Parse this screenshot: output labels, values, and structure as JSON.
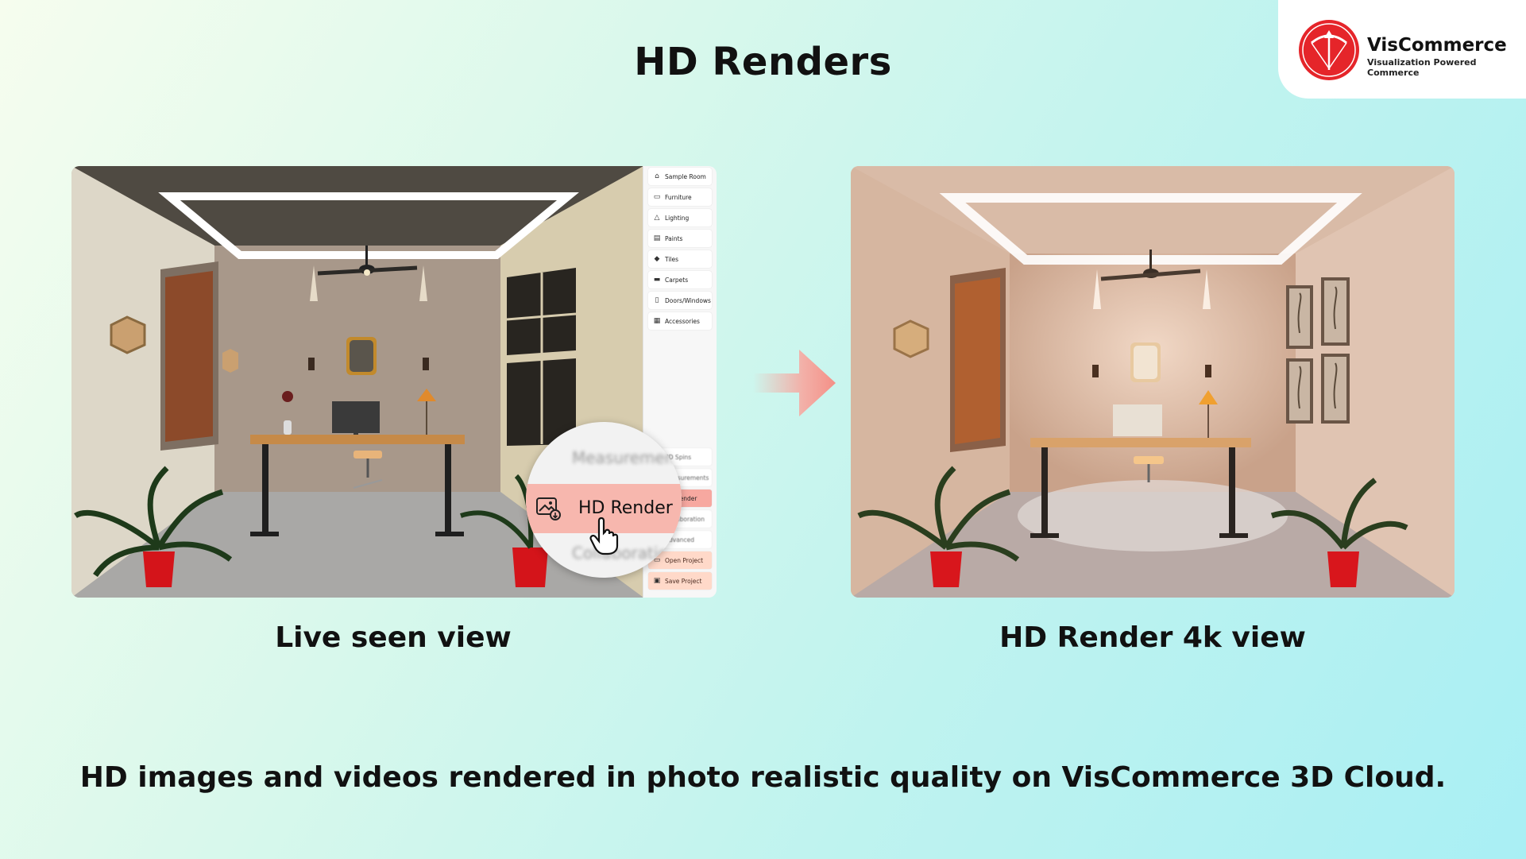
{
  "title": "HD Renders",
  "brand": {
    "name": "VisCommerce",
    "tagline": "Visualization Powered Commerce",
    "accent": "#e5252a"
  },
  "sidebar": {
    "items": [
      {
        "label": "Sample Room",
        "icon": "home-icon"
      },
      {
        "label": "Furniture",
        "icon": "chair-icon"
      },
      {
        "label": "Lighting",
        "icon": "lamp-icon"
      },
      {
        "label": "Paints",
        "icon": "paint-icon"
      },
      {
        "label": "Tiles",
        "icon": "tiles-icon"
      },
      {
        "label": "Carpets",
        "icon": "carpet-icon"
      },
      {
        "label": "Doors/Windows",
        "icon": "door-icon"
      },
      {
        "label": "Accessories",
        "icon": "accessories-icon"
      }
    ],
    "bottom_items": [
      {
        "label": "3D Spins"
      },
      {
        "label": "Measurements"
      },
      {
        "label": "HD Render"
      },
      {
        "label": "Collaboration"
      },
      {
        "label": "Advanced"
      },
      {
        "label": "Open Project"
      },
      {
        "label": "Save Project"
      }
    ]
  },
  "magnifier": {
    "top_label": "Measurements",
    "hd_label": "HD Render",
    "bottom_label": "Collaboration"
  },
  "captions": {
    "left": "Live seen view",
    "right": "HD Render 4k view"
  },
  "footer": "HD images and videos rendered in photo realistic quality on VisCommerce 3D Cloud."
}
